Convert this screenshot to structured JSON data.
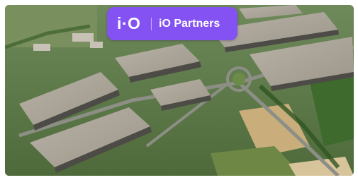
{
  "brand": {
    "logo_text": "i·O",
    "name": "iO Partners",
    "badge_color": "#8452f2"
  },
  "photo": {
    "subject": "aerial-industrial-park",
    "alt": ""
  }
}
